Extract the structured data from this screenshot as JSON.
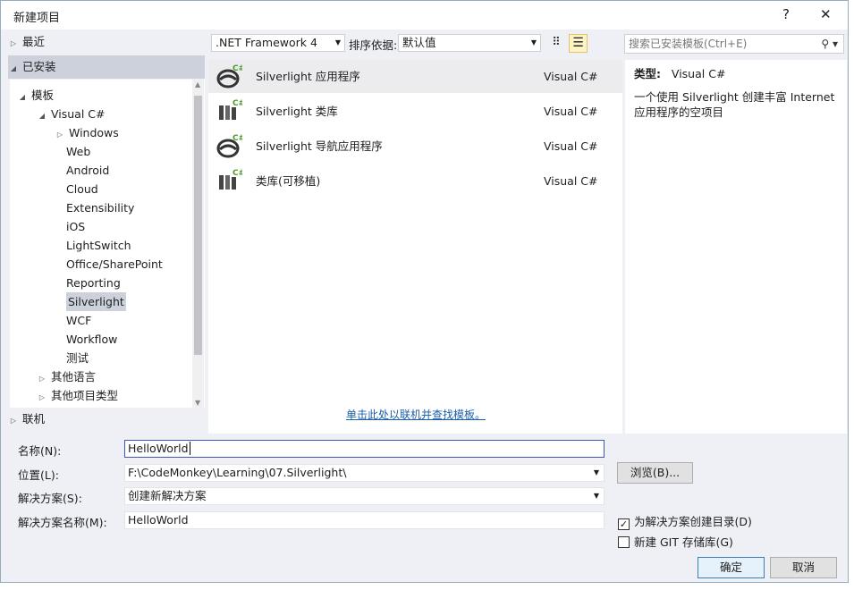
{
  "window": {
    "title": "新建项目",
    "help": "?",
    "close": "✕"
  },
  "left": {
    "recent": "最近",
    "installed": "已安装",
    "online": "联机",
    "tree": [
      {
        "label": "模板",
        "level": 0,
        "expander": "◢"
      },
      {
        "label": "Visual C#",
        "level": 1,
        "expander": "◢"
      },
      {
        "label": "Windows",
        "level": 2,
        "expander": "▷"
      },
      {
        "label": "Web",
        "level": 2
      },
      {
        "label": "Android",
        "level": 2
      },
      {
        "label": "Cloud",
        "level": 2
      },
      {
        "label": "Extensibility",
        "level": 2
      },
      {
        "label": "iOS",
        "level": 2
      },
      {
        "label": "LightSwitch",
        "level": 2
      },
      {
        "label": "Office/SharePoint",
        "level": 2
      },
      {
        "label": "Reporting",
        "level": 2
      },
      {
        "label": "Silverlight",
        "level": 2,
        "selected": true
      },
      {
        "label": "WCF",
        "level": 2
      },
      {
        "label": "Workflow",
        "level": 2
      },
      {
        "label": "测试",
        "level": 2
      },
      {
        "label": "其他语言",
        "level": 1,
        "expander": "▷"
      },
      {
        "label": "其他项目类型",
        "level": 1,
        "expander": "▷"
      }
    ]
  },
  "toolbar": {
    "framework": ".NET Framework 4",
    "sort_label": "排序依据:",
    "sort_value": "默认值"
  },
  "templates": [
    {
      "name": "Silverlight 应用程序",
      "lang": "Visual C#",
      "icon": "silverlight-app-icon"
    },
    {
      "name": "Silverlight 类库",
      "lang": "Visual C#",
      "icon": "class-library-icon"
    },
    {
      "name": "Silverlight 导航应用程序",
      "lang": "Visual C#",
      "icon": "silverlight-nav-app-icon"
    },
    {
      "name": "类库(可移植)",
      "lang": "Visual C#",
      "icon": "portable-library-icon"
    }
  ],
  "online_link": "单击此处以联机并查找模板。",
  "search": {
    "placeholder": "搜索已安装模板(Ctrl+E)"
  },
  "details": {
    "type_label": "类型:",
    "type_value": "Visual C#",
    "description": "一个使用 Silverlight 创建丰富 Internet 应用程序的空项目"
  },
  "form": {
    "name_label": "名称(N):",
    "name_value": "HelloWorld",
    "location_label": "位置(L):",
    "location_value": "F:\\CodeMonkey\\Learning\\07.Silverlight\\",
    "browse": "浏览(B)...",
    "solution_label": "解决方案(S):",
    "solution_value": "创建新解决方案",
    "solution_name_label": "解决方案名称(M):",
    "solution_name_value": "HelloWorld",
    "create_dir": "为解决方案创建目录(D)",
    "create_dir_checked": true,
    "git": "新建 GIT 存储库(G)",
    "git_checked": false,
    "ok": "确定",
    "cancel": "取消"
  }
}
